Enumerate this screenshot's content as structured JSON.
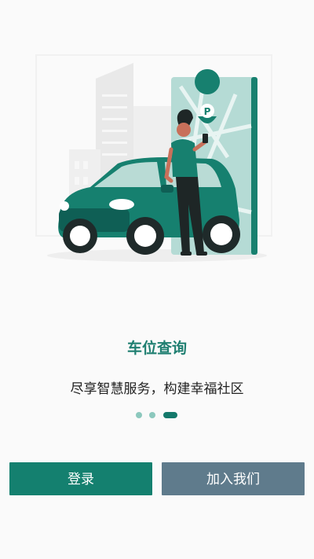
{
  "onboarding": {
    "title": "车位查询",
    "subtitle": "尽享智慧服务，构建幸福社区",
    "pager": {
      "total": 3,
      "active_index": 2
    },
    "colors": {
      "accent": "#14806f",
      "secondary": "#5f7b8c",
      "dot_inactive": "#8cc8bd"
    }
  },
  "actions": {
    "login_label": "登录",
    "join_label": "加入我们"
  },
  "illustration": {
    "icons": [
      "parking-pin-icon",
      "car",
      "person-with-phone",
      "map-phone",
      "city-buildings"
    ]
  }
}
